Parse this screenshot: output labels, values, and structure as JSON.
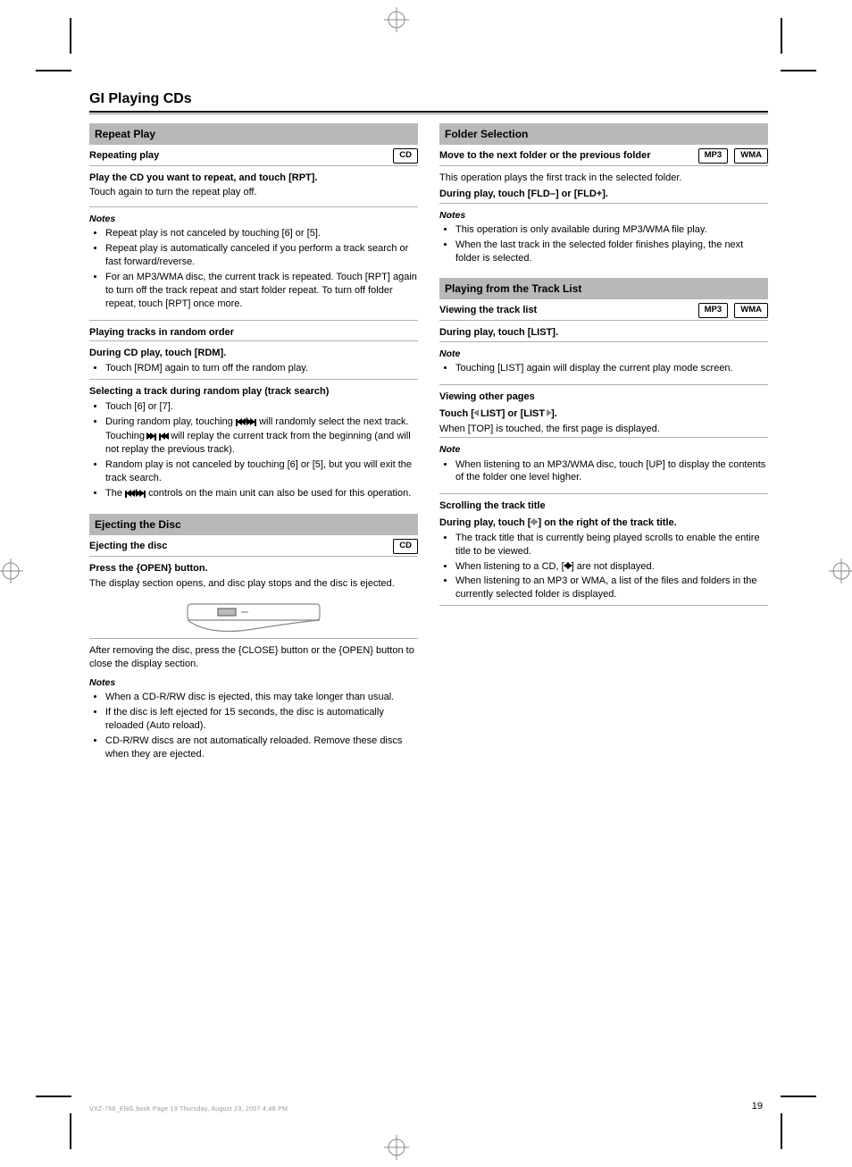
{
  "page": {
    "title": "GI Playing CDs",
    "number": "19"
  },
  "registration_target": "crosshair-target-icon",
  "badges": {
    "cd": "CD",
    "mp3": "MP3",
    "wma": "WMA"
  },
  "left": {
    "sec1": {
      "bar": "Repeat Play",
      "subtitle": "Repeating play",
      "step": "Play the CD you want to repeat, and touch [RPT].",
      "ta": "Touch again to turn the repeat play off.",
      "notes_h": "Notes",
      "notes": [
        "Repeat play is not canceled by touching [6] or [5].",
        "Repeat play is automatically canceled if you perform a track search or fast forward/reverse.",
        "For an MP3/WMA disc, the current track is repeated. Touch [RPT] again to turn off the track repeat and start folder repeat. To turn off folder repeat, touch [RPT] once more."
      ],
      "sec2_sub": "Playing tracks in random order",
      "sec2_step": "During CD play, touch [RDM].",
      "sec2_bul1": "Touch [RDM] again to turn off the random play.",
      "sec2_sub2": "Selecting a track during random play (track search)",
      "sec2_bul2a": "Touch [6] or [7].",
      "sec2_bul2b": "During random play, touching  /  will randomly select the next track. Touching  will replay the current track from the beginning (and will not replay the previous track).",
      "sec2_bul2b_pre": "During random play, touching",
      "sec2_bul2b_mid1": "will randomly select the next track. Touching",
      "sec2_bul2b_mid2": "will replay the current track from the beginning (and will not replay the previous track).",
      "sec2_bul2c": "Random play is not canceled by touching [6] or [5], but you will exit the track search.",
      "sec2_bul2d_pre": "The",
      "sec2_bul2d_post": "controls on the main unit can also be used for this operation."
    },
    "sec3": {
      "bar": "Ejecting the Disc",
      "subtitle": "Ejecting the disc",
      "step": "Press the {OPEN} button.",
      "body": "The display section opens, and disc play stops and the disc is ejected.",
      "after": "After removing the disc, press the {CLOSE} button or the {OPEN} button to close the display section.",
      "notes_h": "Notes",
      "notes": [
        "When a CD-R/RW disc is ejected, this may take longer than usual.",
        "If the disc is left ejected for 15 seconds, the disc is automatically reloaded (Auto reload).",
        "CD-R/RW discs are not automatically reloaded. Remove these discs when they are ejected."
      ]
    }
  },
  "right": {
    "sec1": {
      "bar": "Folder Selection",
      "subtitle": "Move to the next folder or the previous folder",
      "body": "This operation plays the first track in the selected folder.",
      "step": "During play, touch [FLD–] or [FLD+].",
      "notes_h": "Notes",
      "notes": [
        "This operation is only available during MP3/WMA file play.",
        "When the last track in the selected folder finishes playing, the next folder is selected."
      ]
    },
    "sec2": {
      "bar": "Playing from the Track List",
      "subtitle": "Viewing the track list",
      "step": "During play, touch [LIST].",
      "note_h": "Note",
      "note": "Touching [LIST] again will display the current play mode screen.",
      "sub2": "Viewing other pages",
      "sub2_step_pre": "Touch [",
      "sub2_step_mid": " LIST] or [LIST ",
      "sub2_step_post": "].",
      "sub2_body": "When [TOP] is touched, the first page is displayed.",
      "sub2_note_h": "Note",
      "sub2_note": "When listening to an MP3/WMA disc, touch [UP] to display the contents of the folder one level higher.",
      "sub3": "Scrolling the track title",
      "sub3_step_pre": "During play, touch [",
      "sub3_step_post": "] on the right of the track title.",
      "bul": [
        "The track title that is currently being played scrolls to enable the entire title to be viewed.",
        "",
        "When listening to an MP3 or WMA, a list of the files and folders in the currently selected folder is displayed."
      ],
      "bul2_pre": "When listening to a CD, [",
      "bul2_post": "] are not displayed."
    }
  },
  "footer": "VXZ-766_ENG.book  Page 19  Thursday, August 23, 2007  4:48 PM"
}
